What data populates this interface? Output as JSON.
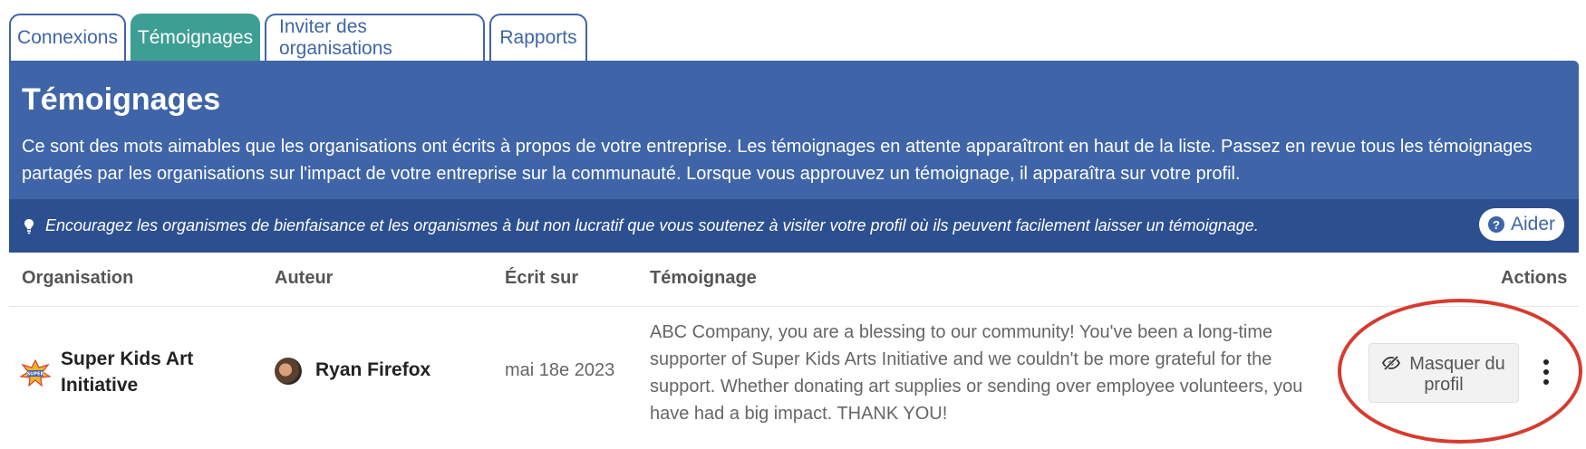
{
  "tabs": [
    {
      "label": "Connexions",
      "active": false
    },
    {
      "label": "Témoignages",
      "active": true
    },
    {
      "label": "Inviter des organisations",
      "active": false
    },
    {
      "label": "Rapports",
      "active": false
    }
  ],
  "banner": {
    "title": "Témoignages",
    "description": "Ce sont des mots aimables que les organisations ont écrits à propos de votre entreprise. Les témoignages en attente apparaîtront en haut de la liste. Passez en revue tous les témoignages partagés par les organisations sur l'impact de votre entreprise sur la communauté. Lorsque vous approuvez un témoignage, il apparaîtra sur votre profil.",
    "tip": "Encouragez les organismes de bienfaisance et les organismes à but non lucratif que vous soutenez à visiter votre profil où ils peuvent facilement laisser un témoignage.",
    "help_label": "Aider",
    "tip_icon": "lightbulb-icon",
    "help_icon": "question-circle-icon"
  },
  "table": {
    "headers": {
      "organisation": "Organisation",
      "auteur": "Auteur",
      "ecrit_sur": "Écrit sur",
      "temoignage": "Témoignage",
      "actions": "Actions"
    },
    "rows": [
      {
        "organisation": "Super Kids Art Initiative",
        "auteur": "Ryan Firefox",
        "ecrit_sur": "mai 18e 2023",
        "temoignage": "ABC Company, you are a blessing to our community! You've been a long-time supporter of Super Kids Arts Initiative and we couldn't be more grateful for the support. Whether donating art supplies or sending over employee volunteers, you have had a big impact. THANK YOU!",
        "action_label": "Masquer du profil",
        "action_icon": "eye-slash-icon",
        "menu_icon": "kebab-menu-icon"
      }
    ]
  },
  "colors": {
    "brand_blue": "#3f65a8",
    "tip_bar": "#2c4f8f",
    "active_tab": "#3d9e94",
    "highlight": "#d63b2f"
  }
}
